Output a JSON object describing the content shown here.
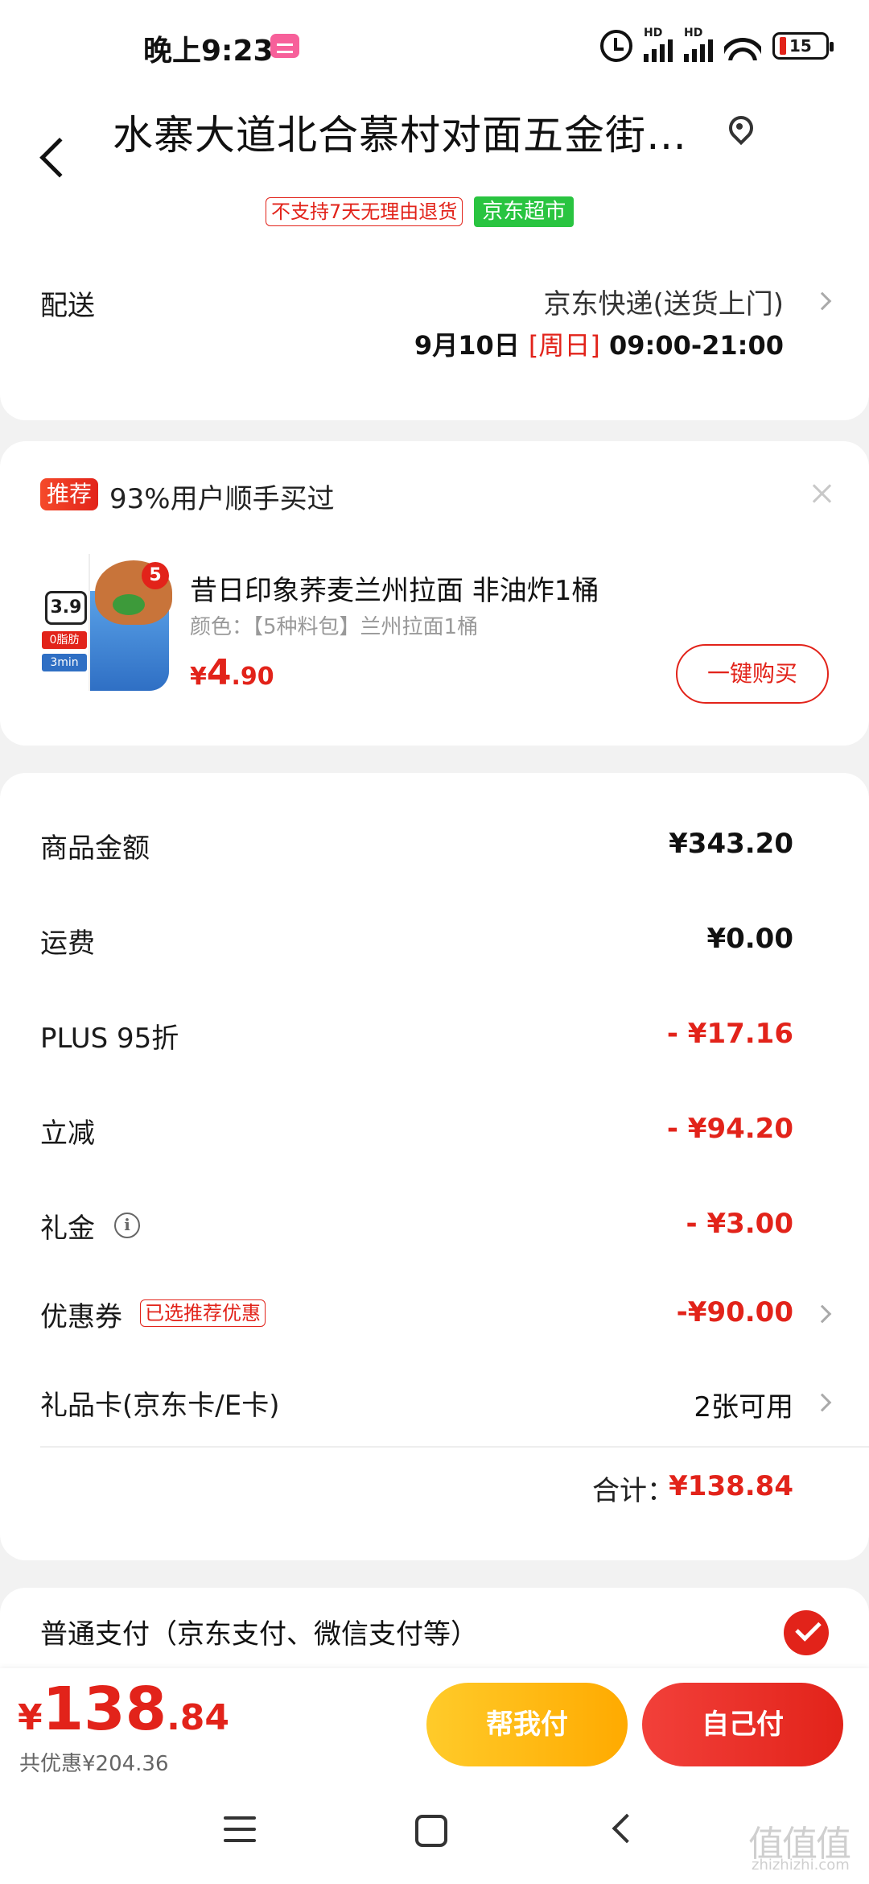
{
  "status_bar": {
    "time": "晚上9:23",
    "hd1": "HD",
    "hd2": "HD",
    "battery": "15"
  },
  "header": {
    "address": "水寨大道北合慕村对面五金街…",
    "tag_no_return": "不支持7天无理由退货",
    "tag_store": "京东超市",
    "delivery_label": "配送",
    "delivery_method": "京东快递(送货上门)",
    "delivery_date": "9月10日",
    "delivery_day": "[周日]",
    "delivery_hours": "09:00-21:00"
  },
  "recommend": {
    "badge": "推荐",
    "title": "93%用户顺手买过",
    "product_name": "昔日印象荞麦兰州拉面 非油炸1桶",
    "product_spec": "颜色：【5种料包】兰州拉面1桶",
    "price_currency": "¥",
    "price_int": "4",
    "price_dec": ".90",
    "buy_button": "一键购买",
    "img_price": "3.9",
    "img_label1": "0脂肪",
    "img_label2": "3min",
    "img_five": "5"
  },
  "summary": {
    "rows": [
      {
        "label": "商品金额",
        "value": "¥343.20"
      },
      {
        "label": "运费",
        "value": "¥0.00"
      },
      {
        "label": "PLUS 95折",
        "value": "- ¥17.16"
      },
      {
        "label": "立减",
        "value": "- ¥94.20"
      },
      {
        "label": "礼金",
        "value": "- ¥3.00"
      },
      {
        "label": "优惠券",
        "value": "-¥90.00",
        "tag": "已选推荐优惠"
      },
      {
        "label": "礼品卡(京东卡/E卡)",
        "value": "2张可用"
      }
    ],
    "total_label": "合计：",
    "total_value": "¥138.84"
  },
  "payment": {
    "method": "普通支付（京东支付、微信支付等）"
  },
  "bottom": {
    "price_currency": "¥",
    "price_int": "138",
    "price_dec": ".84",
    "saved": "共优惠¥204.36",
    "help_pay": "帮我付",
    "self_pay": "自己付"
  },
  "watermark": {
    "main": "值值值",
    "sub": "zhizhizhi.com"
  },
  "colors": {
    "accent_red": "#e2231a",
    "store_green": "#29c440",
    "help_yellow": "#ffb300"
  }
}
